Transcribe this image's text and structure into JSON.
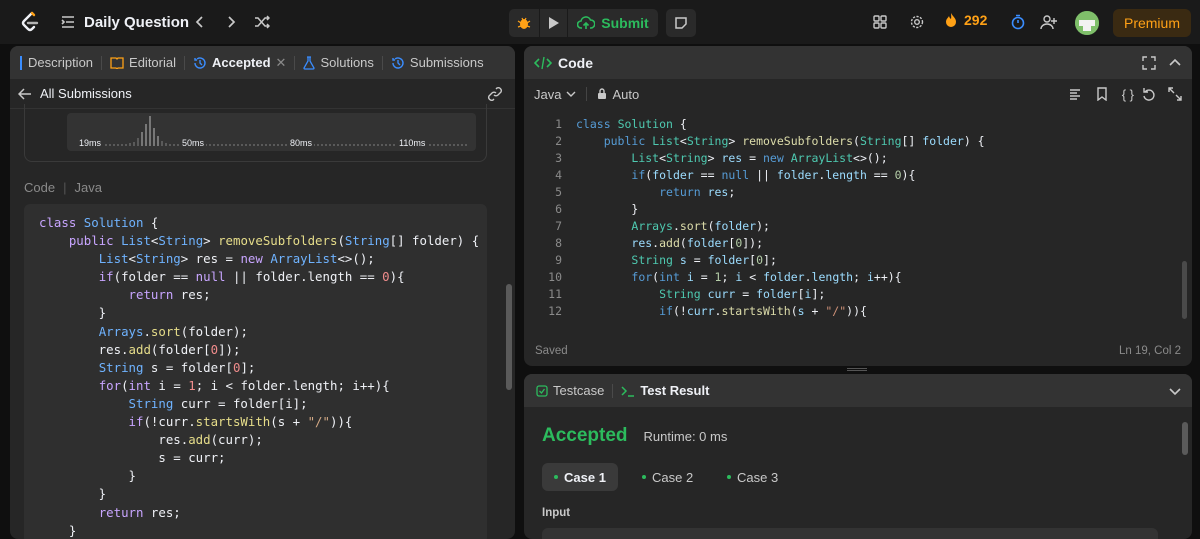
{
  "topbar": {
    "problem_list_title": "Daily Question",
    "submit_label": "Submit",
    "streak": "292",
    "premium_label": "Premium"
  },
  "left_tabs": [
    "Description",
    "Editorial",
    "Accepted",
    "Solutions",
    "Submissions"
  ],
  "submissions_bar": {
    "label": "All Submissions"
  },
  "histogram": {
    "labels": [
      "19ms",
      "50ms",
      "80ms",
      "110ms"
    ]
  },
  "code_header": {
    "label": "Code",
    "language": "Java"
  },
  "editor": {
    "title": "Code",
    "language": "Java",
    "mode": "Auto",
    "status": "Saved",
    "cursor": "Ln 19, Col 2",
    "line_numbers": [
      "1",
      "2",
      "3",
      "4",
      "5",
      "6",
      "7",
      "8",
      "9",
      "10",
      "11",
      "12"
    ]
  },
  "test_tabs": {
    "testcase": "Testcase",
    "result": "Test Result"
  },
  "result": {
    "status": "Accepted",
    "runtime": "Runtime: 0 ms"
  },
  "cases": [
    "Case 1",
    "Case 2",
    "Case 3"
  ],
  "input_label": "Input",
  "colors": {
    "accent_green": "#2cbb5d",
    "accent_orange": "#ffa116",
    "panel": "#262626",
    "background": "#0f0f0f"
  },
  "icons": [
    "leetcode-logo",
    "list-icon",
    "chevron-left-icon",
    "chevron-right-icon",
    "shuffle-icon",
    "debug-icon",
    "play-icon",
    "cloud-upload-icon",
    "note-icon",
    "layout-icon",
    "gear-icon",
    "fire-icon",
    "timer-icon",
    "add-user-icon",
    "avatar"
  ]
}
